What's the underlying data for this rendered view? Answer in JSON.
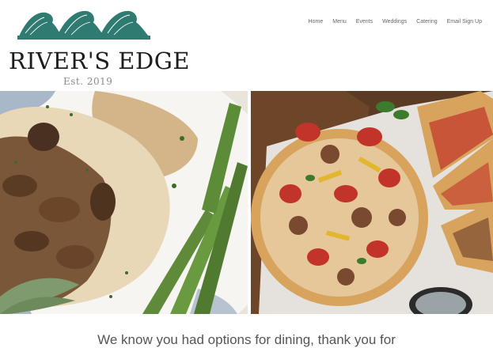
{
  "brand": {
    "name": "RIVER'S EDGE",
    "established": "Est. 2019",
    "logo_icon": "waves-logo",
    "accent_color": "#2f7b72"
  },
  "nav": {
    "items": [
      {
        "label": "Home"
      },
      {
        "label": "Menu"
      },
      {
        "label": "Events"
      },
      {
        "label": "Weddings"
      },
      {
        "label": "Catering"
      },
      {
        "label": "Email Sign Up"
      }
    ]
  },
  "gallery": {
    "photos": [
      {
        "subject": "chicken-mushroom-asparagus-photo"
      },
      {
        "subject": "vegetable-pizza-photo"
      }
    ]
  },
  "intro": {
    "text": "We know you had options for dining, thank you for"
  }
}
